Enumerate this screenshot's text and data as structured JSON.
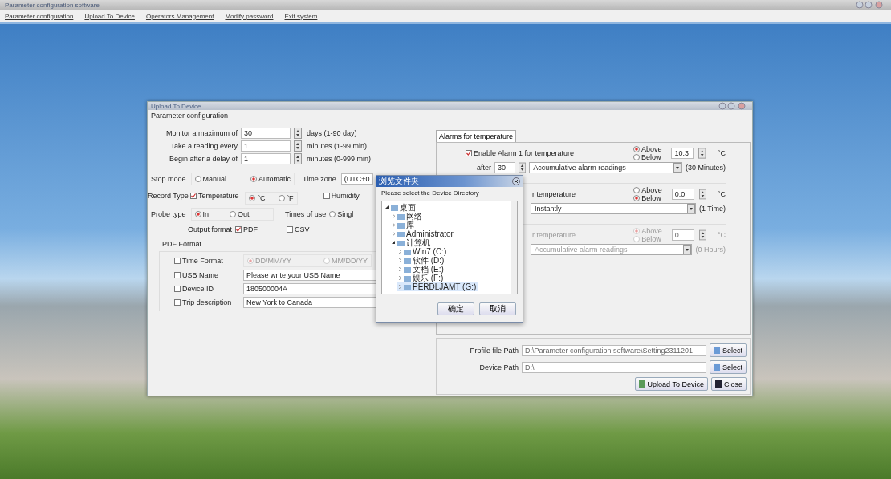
{
  "app_title": "Parameter configuration software",
  "menu": [
    "Parameter configuration",
    "Upload To Device",
    "Operators Management",
    "Modify password",
    "Exit system"
  ],
  "window": {
    "title": "Upload To Device"
  },
  "group_title": "Parameter configuration",
  "settings": [
    {
      "label": "Monitor a maximum of",
      "value": "30",
      "hint": "days (1-90 day)"
    },
    {
      "label": "Take a reading every",
      "value": "1",
      "hint": "minutes (1-99 min)"
    },
    {
      "label": "Begin after a delay of",
      "value": "1",
      "hint": "minutes (0-999 min)"
    }
  ],
  "stop_mode": {
    "label": "Stop mode",
    "options": [
      {
        "label": "Manual",
        "selected": false
      },
      {
        "label": "Automatic",
        "selected": true
      }
    ]
  },
  "time_zone": {
    "label": "Time zone",
    "value": "(UTC+0"
  },
  "record_type": {
    "label": "Record Type",
    "temperature": {
      "label": "Temperature",
      "checked": true
    },
    "units": [
      {
        "label": "°C",
        "selected": true
      },
      {
        "label": "°F",
        "selected": false
      }
    ],
    "humidity": {
      "label": "Humidity",
      "checked": false
    }
  },
  "probe_type": {
    "label": "Probe type",
    "options": [
      {
        "label": "In",
        "selected": true
      },
      {
        "label": "Out",
        "selected": false
      }
    ]
  },
  "times_of_use": {
    "label": "Times of use",
    "options": [
      {
        "label": "Singl",
        "selected": false
      }
    ]
  },
  "output_format": {
    "label": "Output format",
    "options": [
      {
        "label": "PDF",
        "checked": true
      },
      {
        "label": "CSV",
        "checked": false
      }
    ]
  },
  "pdf_format": {
    "title": "PDF Format",
    "rows": [
      {
        "kind": "radios",
        "label": "Time Format",
        "checked": false,
        "disabled": true,
        "options": [
          {
            "label": "DD/MM/YY",
            "selected": true
          },
          {
            "label": "MM/DD/YY",
            "selected": false
          }
        ]
      },
      {
        "kind": "text",
        "label": "USB Name",
        "checked": false,
        "value": "Please write your USB Name"
      },
      {
        "kind": "text",
        "label": "Device ID",
        "checked": false,
        "value": "180500004A"
      },
      {
        "kind": "text",
        "label": "Trip description",
        "checked": false,
        "value": "New York to Canada"
      }
    ]
  },
  "alarm_tab": {
    "label": "Alarms for temperature",
    "selected": true
  },
  "alarms": [
    {
      "kind": "checkbox",
      "label": "Enable Alarm 1 for temperature",
      "checked": true,
      "disabled": false,
      "direction": [
        {
          "label": "Above",
          "selected": true
        },
        {
          "label": "Below",
          "selected": false
        }
      ],
      "value": "10.3",
      "unit": "°C",
      "delay_label": "after",
      "delay_value": "30",
      "mode": "Accumulative alarm readings",
      "duration": "(30 Minutes)"
    },
    {
      "kind": "partial",
      "label": "r temperature",
      "disabled": false,
      "direction": [
        {
          "label": "Above",
          "selected": false
        },
        {
          "label": "Below",
          "selected": true
        }
      ],
      "value": "0.0",
      "unit": "°C",
      "mode": "Instantly",
      "duration": "(1 Time)"
    },
    {
      "kind": "partial",
      "label": "r temperature",
      "disabled": true,
      "direction": [
        {
          "label": "Above",
          "selected": true
        },
        {
          "label": "Below",
          "selected": false
        }
      ],
      "value": "0",
      "unit": "°C",
      "mode": "Accumulative alarm readings",
      "duration": "(0 Hours)"
    }
  ],
  "paths": [
    {
      "label": "Profile file Path",
      "value": "D:\\Parameter configuration software\\Setting2311201",
      "button": "Select"
    },
    {
      "label": "Device Path",
      "value": "D:\\",
      "button": "Select"
    }
  ],
  "actions": [
    "Upload To Device",
    "Close"
  ],
  "folder_dialog": {
    "title": "浏览文件夹",
    "message": "Please select the Device Directory",
    "tree": [
      {
        "label": "桌面",
        "selected": false,
        "expanded": true,
        "children": [
          {
            "label": "网络",
            "selected": false,
            "expanded": false
          },
          {
            "label": "库",
            "selected": false,
            "expanded": false
          },
          {
            "label": "Administrator",
            "selected": false,
            "expanded": false
          },
          {
            "label": "计算机",
            "selected": false,
            "expanded": true,
            "children": [
              {
                "label": "Win7 (C:)",
                "selected": false,
                "expanded": false
              },
              {
                "label": "软件 (D:)",
                "selected": false,
                "expanded": false
              },
              {
                "label": "文档 (E:)",
                "selected": false,
                "expanded": false
              },
              {
                "label": "娱乐 (F:)",
                "selected": false,
                "expanded": false
              },
              {
                "label": "PERDLJAMT (G:)",
                "selected": true,
                "expanded": false
              }
            ]
          }
        ]
      }
    ],
    "buttons": [
      "确定",
      "取消"
    ]
  }
}
